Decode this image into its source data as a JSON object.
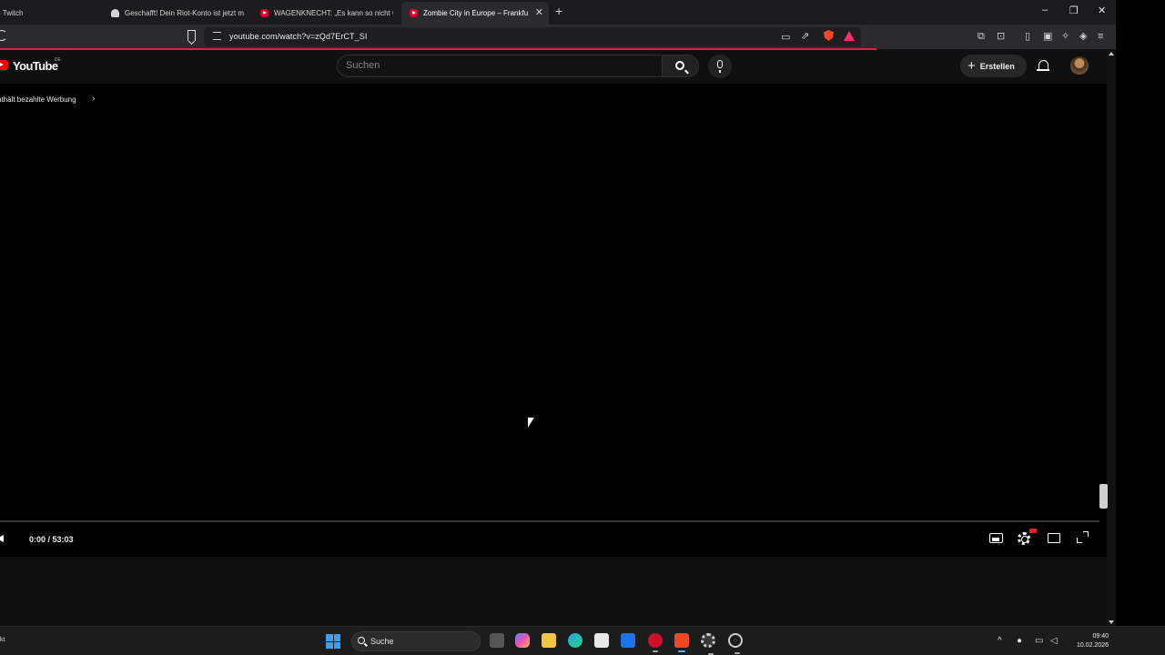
{
  "browser": {
    "tabs": [
      {
        "title": "- Twitch",
        "icon": "twitch-icon"
      },
      {
        "title": "Geschafft! Dein Riot-Konto ist jetzt m",
        "icon": "riot-icon"
      },
      {
        "title": "WAGENKNECHT: „Es kann so nicht w",
        "icon": "youtube-icon"
      },
      {
        "title": "Zombie City in Europe – Frankfu",
        "icon": "youtube-icon",
        "active": true
      }
    ],
    "new_tab": "+",
    "url": "youtube.com/watch?v=zQd7ErCT_SI",
    "window_controls": {
      "minimize": "–",
      "restore": "❐",
      "close": "✕"
    }
  },
  "youtube": {
    "logo_text": "YouTube",
    "country": "DE",
    "search_placeholder": "Suchen",
    "create_label": "Erstellen",
    "create_plus": "+"
  },
  "player": {
    "promo_text": "nthält bezahlte Werbung",
    "promo_chevron": "›",
    "time": "0:00 / 53:03",
    "progress": 0
  },
  "taskbar": {
    "left_text": "kt",
    "search_label": "Suche",
    "tray_chevron": "^",
    "time": "09:40",
    "date": "10.02.2026"
  },
  "colors": {
    "youtube_red": "#ff0000",
    "brave_orange": "#f0492a",
    "windows_blue": "#3aa0f0"
  }
}
